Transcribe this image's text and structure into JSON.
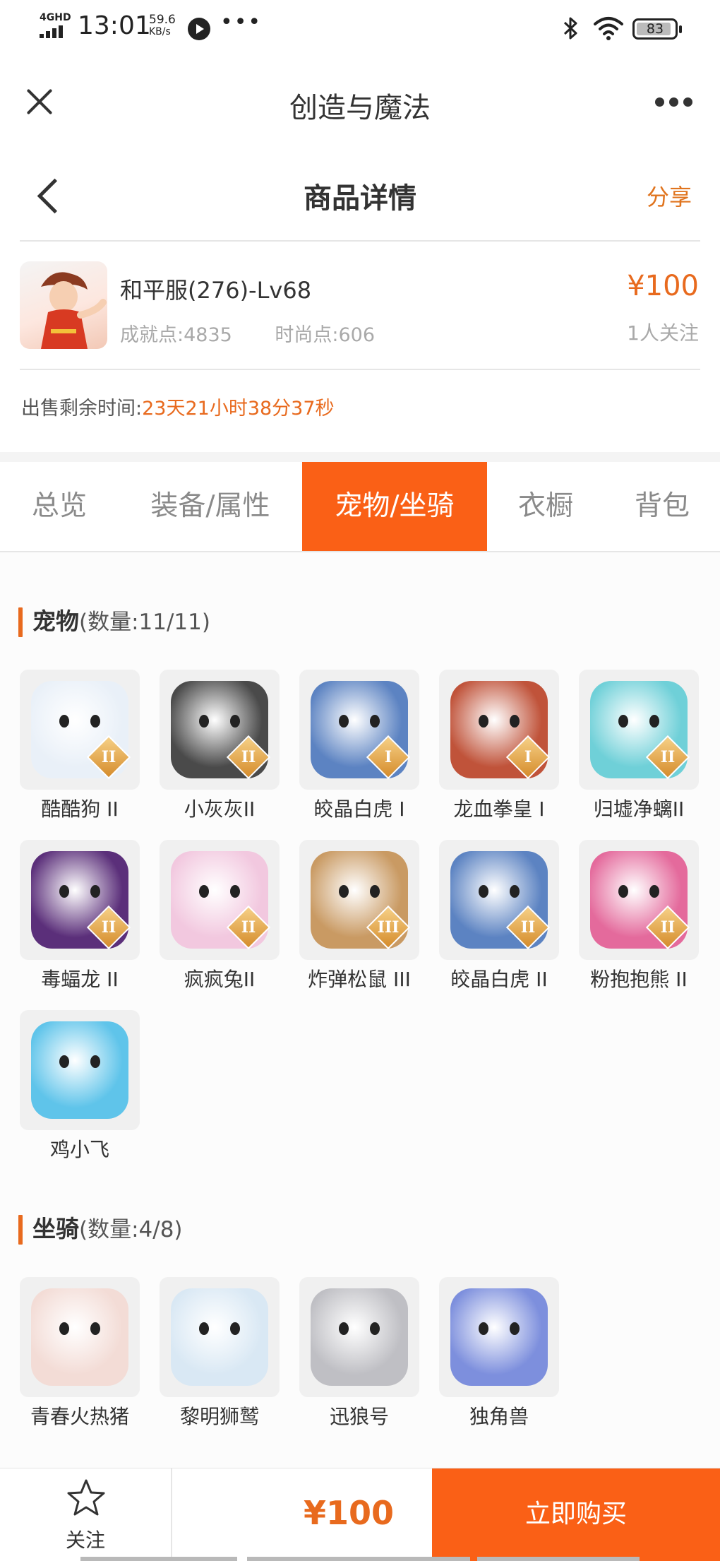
{
  "status_bar": {
    "network": "4GHD",
    "time": "13:01",
    "speed_value": "59.6",
    "speed_unit": "KB/s",
    "dots": "•••",
    "battery": "83",
    "icons": [
      "play-icon",
      "bluetooth-icon",
      "wifi-icon",
      "battery-icon"
    ]
  },
  "app_bar": {
    "title": "创造与魔法"
  },
  "page_header": {
    "title": "商品详情",
    "share": "分享"
  },
  "product": {
    "server": "和平服(276)-Lv68",
    "achievement": "成就点:4835",
    "fashion": "时尚点:606",
    "price": "¥100",
    "watchers": "1人关注"
  },
  "sale_time": {
    "label": "出售剩余时间:",
    "value": "23天21小时38分37秒"
  },
  "tabs": [
    "总览",
    "装备/属性",
    "宠物/坐骑",
    "衣橱",
    "背包"
  ],
  "active_tab": "宠物/坐骑",
  "pets": {
    "title": "宠物",
    "count": "(数量:11/11)",
    "items": [
      {
        "name": "酷酷狗 II",
        "tier": "II",
        "color": "#e9f0f8"
      },
      {
        "name": "小灰灰II",
        "tier": "II",
        "color": "#4a4a4a"
      },
      {
        "name": "皎晶白虎 I",
        "tier": "I",
        "color": "#5c83c2"
      },
      {
        "name": "龙血拳皇 I",
        "tier": "I",
        "color": "#c0533a"
      },
      {
        "name": "归墟净螭II",
        "tier": "II",
        "color": "#6fd0d8"
      },
      {
        "name": "毒蝠龙 II",
        "tier": "II",
        "color": "#5b2f7a"
      },
      {
        "name": "疯疯兔II",
        "tier": "II",
        "color": "#f2c8df"
      },
      {
        "name": "炸弹松鼠 III",
        "tier": "III",
        "color": "#c99a63"
      },
      {
        "name": "皎晶白虎 II",
        "tier": "II",
        "color": "#5c83c2"
      },
      {
        "name": "粉抱抱熊 II",
        "tier": "II",
        "color": "#e46a9c"
      },
      {
        "name": "鸡小飞",
        "tier": "",
        "color": "#5fc4ea"
      }
    ]
  },
  "mounts": {
    "title": "坐骑",
    "count": "(数量:4/8)",
    "items": [
      {
        "name": "青春火热猪",
        "color": "#f3dcd6"
      },
      {
        "name": "黎明狮鹫",
        "color": "#d9e8f4"
      },
      {
        "name": "迅狼号",
        "color": "#bfbfc4"
      },
      {
        "name": "独角兽",
        "color": "#7d8fdd"
      }
    ]
  },
  "bottom_bar": {
    "follow_label": "关注",
    "price": "¥100",
    "buy_label": "立即购买"
  },
  "colors": {
    "accent": "#fa6016",
    "price": "#e86a1e"
  }
}
